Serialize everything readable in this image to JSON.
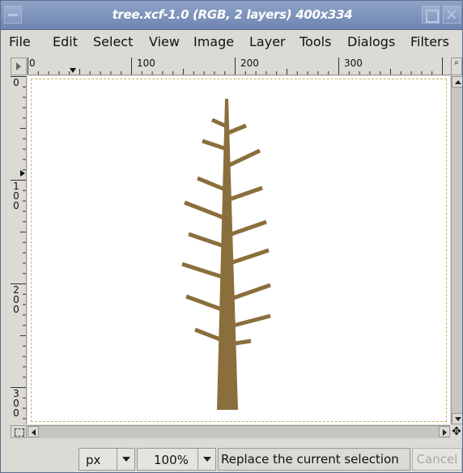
{
  "window": {
    "title": "tree.xcf-1.0 (RGB, 2 layers) 400x334"
  },
  "menu": [
    "File",
    "Edit",
    "Select",
    "View",
    "Image",
    "Layer",
    "Tools",
    "Dialogs",
    "Filters"
  ],
  "rulers": {
    "horizontal_labels": [
      "0",
      "100",
      "200",
      "300"
    ],
    "vertical_labels": [
      "0",
      "100",
      "200",
      "300"
    ]
  },
  "status": {
    "unit": "px",
    "zoom": "100%",
    "message": "Replace the current selection",
    "cancel_label": "Cancel"
  },
  "colors": {
    "tree": "#8a6f3c",
    "titlebar": "#7a8fbb",
    "canvas_border": "#c9b26a"
  },
  "icons": [
    "menu-icon",
    "maximize-icon",
    "close-icon",
    "ruler-menu-icon",
    "quick-mask-icon",
    "navigate-icon"
  ]
}
